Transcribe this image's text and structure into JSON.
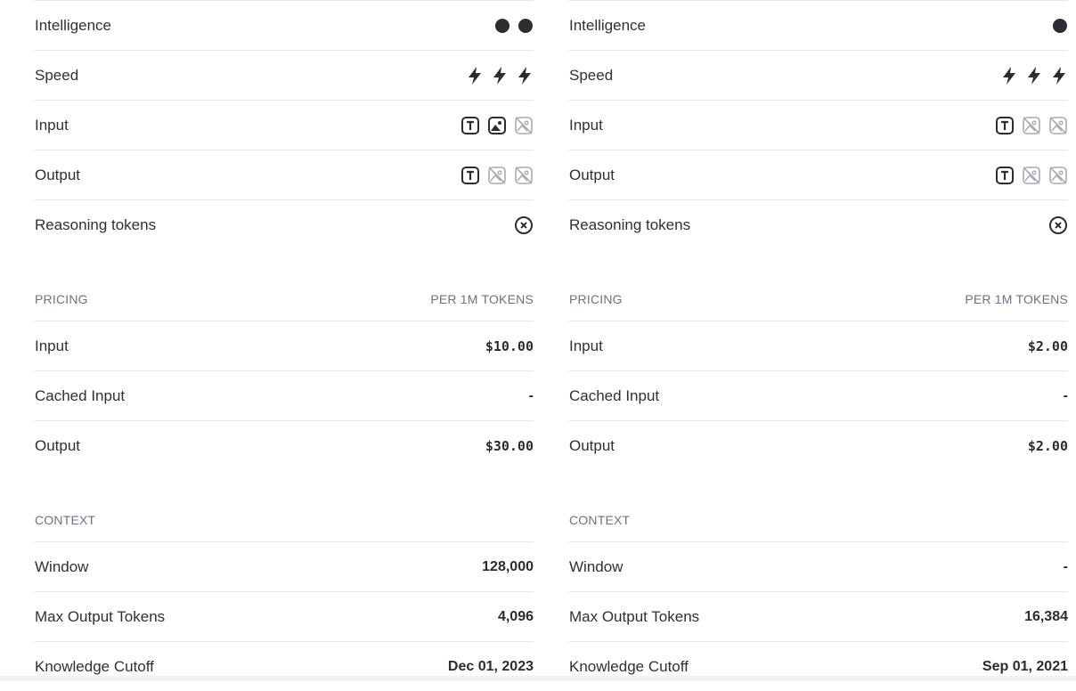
{
  "models": [
    {
      "capabilities": {
        "intelligence_label": "Intelligence",
        "intelligence_level": 2,
        "speed_label": "Speed",
        "speed_level": 3,
        "input_label": "Input",
        "input_icons": [
          "text-icon",
          "image-icon",
          "image-disabled-icon"
        ],
        "output_label": "Output",
        "output_icons": [
          "text-icon",
          "image-disabled-icon",
          "image-disabled-icon"
        ],
        "reasoning_label": "Reasoning tokens",
        "reasoning_icon": "x-circle-icon"
      },
      "pricing": {
        "heading": "PRICING",
        "unit": "PER 1M TOKENS",
        "input_label": "Input",
        "input_value": "$10.00",
        "cached_label": "Cached Input",
        "cached_value": "-",
        "output_label": "Output",
        "output_value": "$30.00"
      },
      "context": {
        "heading": "CONTEXT",
        "window_label": "Window",
        "window_value": "128,000",
        "max_output_label": "Max Output Tokens",
        "max_output_value": "4,096",
        "cutoff_label": "Knowledge Cutoff",
        "cutoff_value": "Dec 01, 2023"
      }
    },
    {
      "capabilities": {
        "intelligence_label": "Intelligence",
        "intelligence_level": 1,
        "speed_label": "Speed",
        "speed_level": 3,
        "input_label": "Input",
        "input_icons": [
          "text-icon",
          "image-disabled-icon",
          "image-disabled-icon"
        ],
        "output_label": "Output",
        "output_icons": [
          "text-icon",
          "image-disabled-icon",
          "image-disabled-icon"
        ],
        "reasoning_label": "Reasoning tokens",
        "reasoning_icon": "x-circle-icon"
      },
      "pricing": {
        "heading": "PRICING",
        "unit": "PER 1M TOKENS",
        "input_label": "Input",
        "input_value": "$2.00",
        "cached_label": "Cached Input",
        "cached_value": "-",
        "output_label": "Output",
        "output_value": "$2.00"
      },
      "context": {
        "heading": "CONTEXT",
        "window_label": "Window",
        "window_value": "-",
        "max_output_label": "Max Output Tokens",
        "max_output_value": "16,384",
        "cutoff_label": "Knowledge Cutoff",
        "cutoff_value": "Sep 01, 2021"
      }
    }
  ]
}
